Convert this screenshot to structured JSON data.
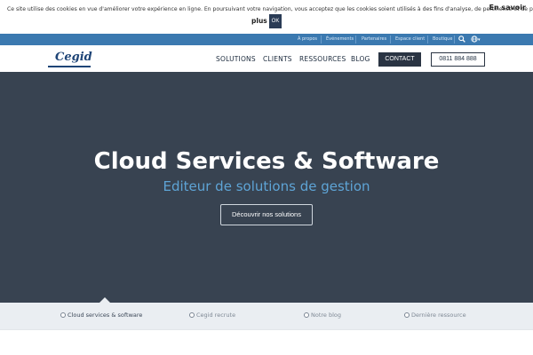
{
  "cookie": {
    "text": "Ce site utilise des cookies en vue d'améliorer votre expérience en ligne. En poursuivant votre navigation, vous acceptez que les cookies soient utilisés à des fins d'analyse, de pertinence et de publicité.",
    "more_label_1": "En savoir",
    "more_label_2": "plus",
    "ok_label": "OK"
  },
  "utility_nav": {
    "items": [
      "À propos",
      "Événements",
      "Partenaires",
      "Espace client",
      "Boutique"
    ]
  },
  "logo": {
    "text": "Cegid"
  },
  "nav": {
    "items": [
      "SOLUTIONS",
      "CLIENTS",
      "RESSOURCES",
      "BLOG"
    ],
    "contact_label": "CONTACT",
    "phone_label": "0811 884 888"
  },
  "hero": {
    "title": "Cloud Services & Software",
    "subtitle": "Editeur de solutions de gestion",
    "cta_label": "Découvrir nos solutions"
  },
  "tabs": {
    "items": [
      "Cloud services & software",
      "Cegid recrute",
      "Notre blog",
      "Dernière ressource"
    ]
  },
  "colors": {
    "utility_bar": "#3b79b0",
    "hero_bg": "#384351",
    "hero_subtitle": "#5ea4d6",
    "contact_button": "#2a3443",
    "brand": "#1f4577"
  }
}
